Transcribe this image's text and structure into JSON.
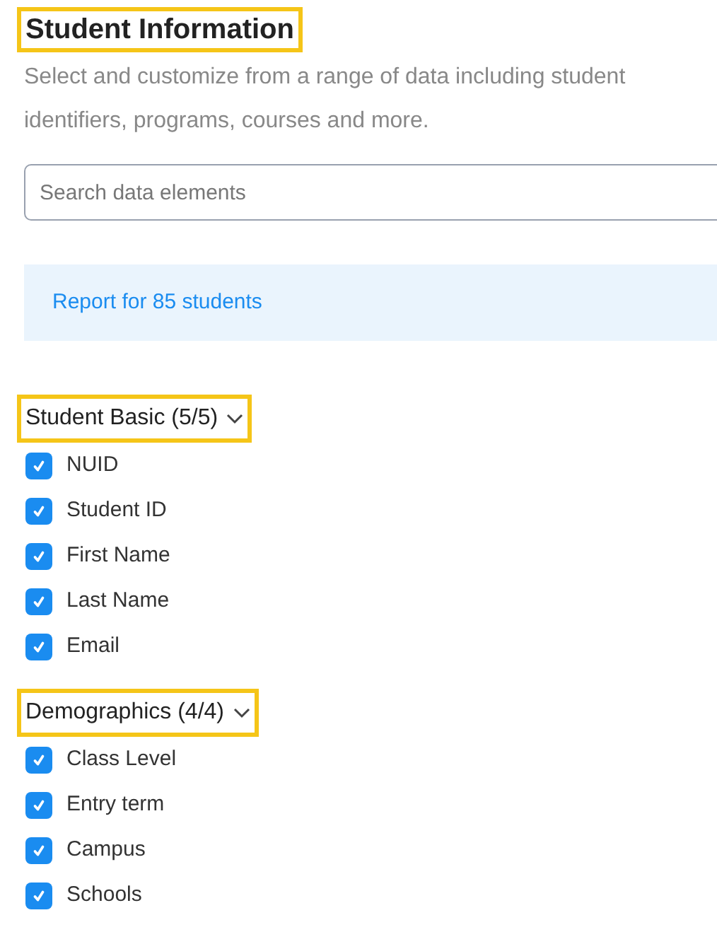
{
  "title": {
    "text": "Student Information",
    "highlighted": true
  },
  "description": "Select and customize from a range of data including student identifiers, programs, courses and more.",
  "search": {
    "placeholder": "Search data elements"
  },
  "banner": {
    "text": "Report for 85 students"
  },
  "groups": [
    {
      "label": "Student Basic (5/5)",
      "highlighted": true,
      "expanded": true,
      "items": [
        {
          "label": "NUID",
          "checked": true
        },
        {
          "label": "Student ID",
          "checked": true
        },
        {
          "label": "First Name",
          "checked": true
        },
        {
          "label": "Last Name",
          "checked": true
        },
        {
          "label": "Email",
          "checked": true
        }
      ]
    },
    {
      "label": "Demographics (4/4)",
      "highlighted": true,
      "expanded": true,
      "items": [
        {
          "label": "Class Level",
          "checked": true
        },
        {
          "label": "Entry term",
          "checked": true
        },
        {
          "label": "Campus",
          "checked": true
        },
        {
          "label": "Schools",
          "checked": true
        }
      ]
    }
  ]
}
